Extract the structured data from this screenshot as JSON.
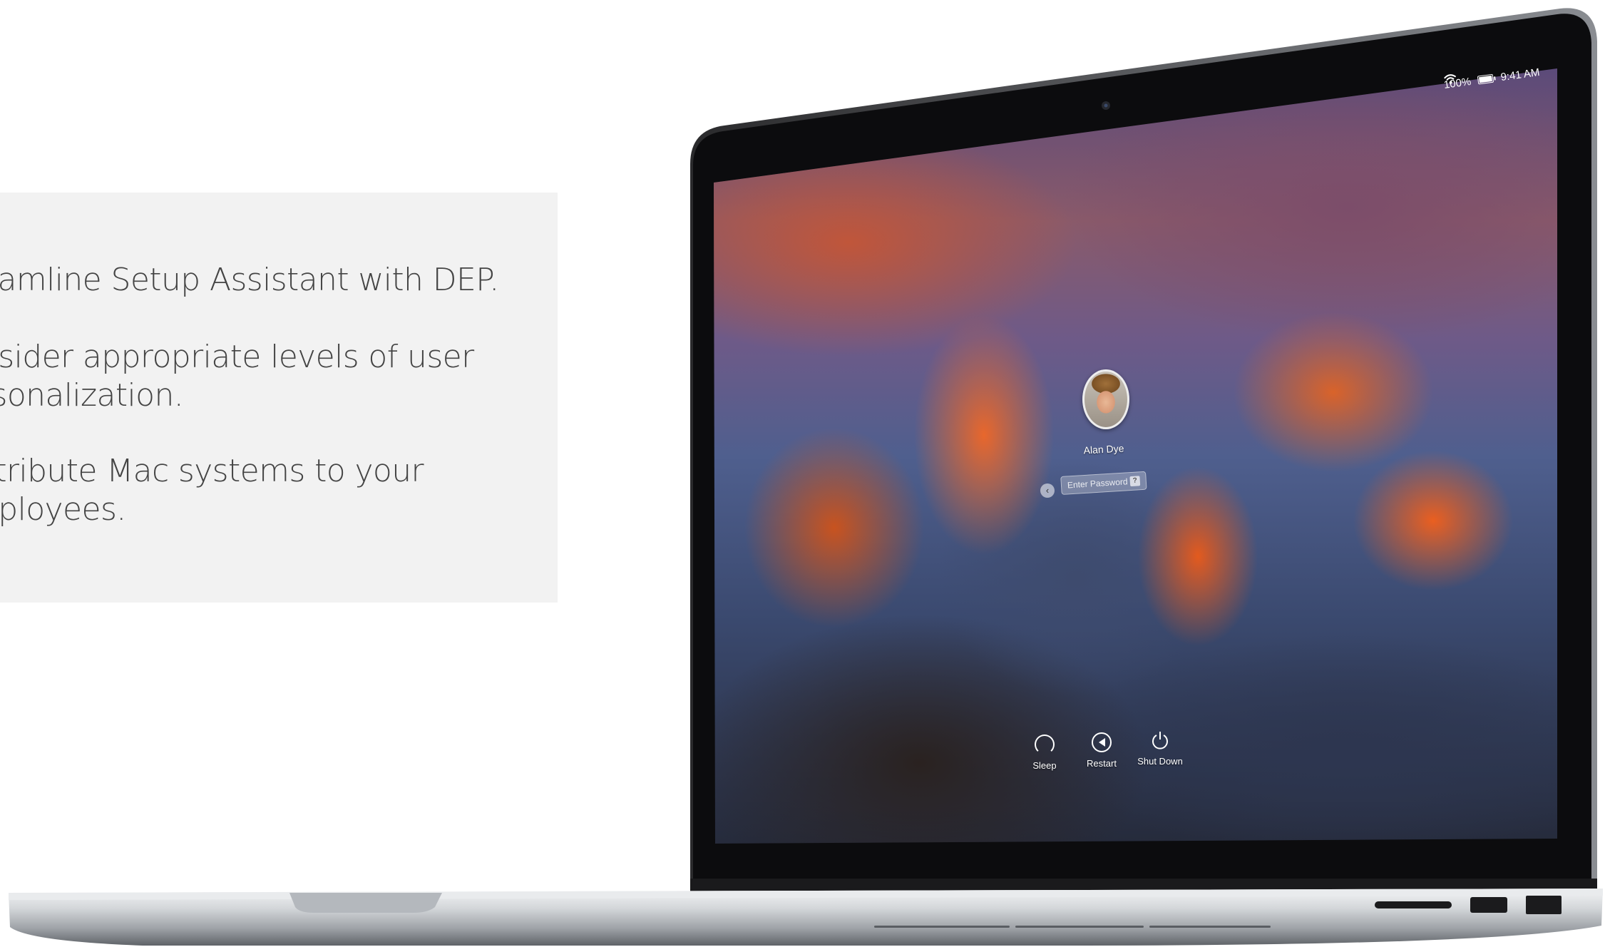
{
  "panel": {
    "bullets": [
      "eamline Setup Assistant with DEP.",
      "nsider appropriate levels of user\nrsonalization.",
      "stribute Mac systems to your\nnployees."
    ]
  },
  "mac_screen": {
    "status_bar": {
      "battery": "100%",
      "time": "9:41 AM",
      "icons": [
        "battery-icon",
        "wifi-icon"
      ]
    },
    "login": {
      "user_name": "Alan Dye",
      "password_placeholder": "Enter Password",
      "hint_icon": "?"
    },
    "power_buttons": [
      {
        "label": "Sleep",
        "icon": "sleep-icon"
      },
      {
        "label": "Restart",
        "icon": "restart-icon"
      },
      {
        "label": "Shut Down",
        "icon": "power-icon"
      }
    ]
  },
  "colors": {
    "panel_bg": "#f2f2f2",
    "panel_text": "#444444",
    "bezel": "#0c0c0e",
    "aluminum": "#c9ccd0"
  }
}
